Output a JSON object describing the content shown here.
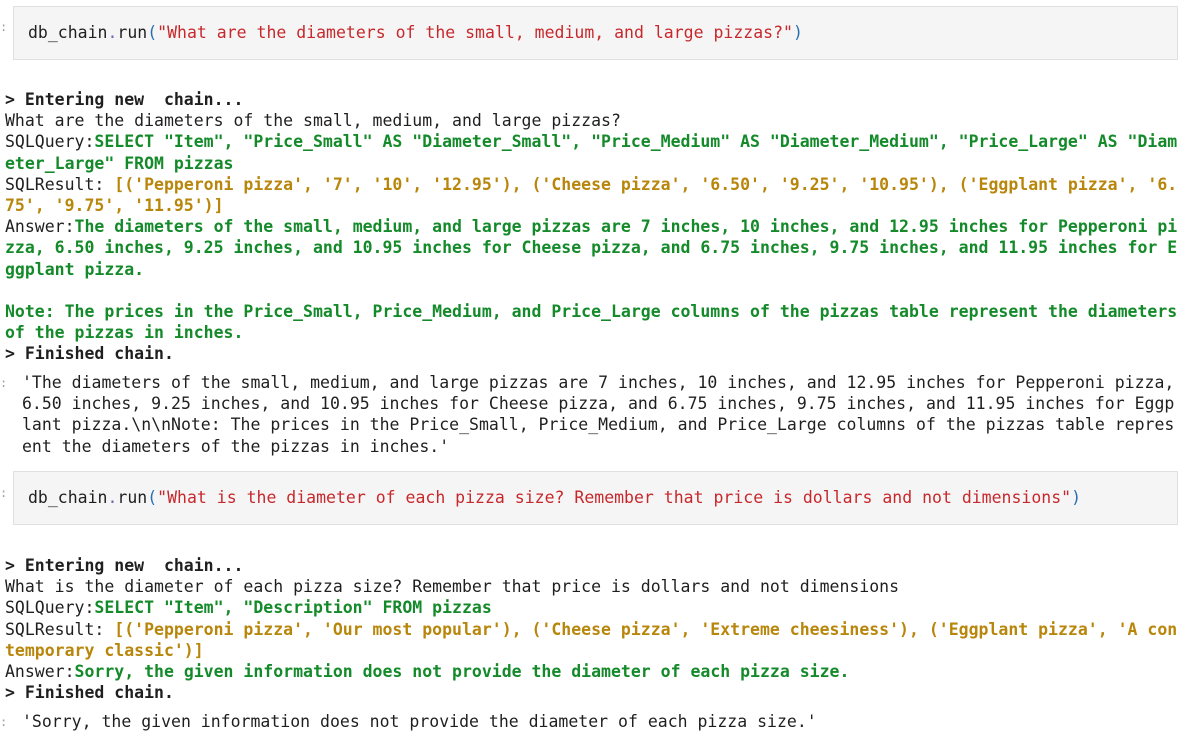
{
  "cells": [
    {
      "input": {
        "obj": "db_chain",
        "dot": ".",
        "method": "run",
        "open_paren": "(",
        "string": "\"What are the diameters of the small, medium, and large pizzas?\"",
        "close_paren": ")"
      },
      "log": {
        "entering": "> Entering new  chain...",
        "question": "What are the diameters of the small, medium, and large pizzas?",
        "sql_label": "SQLQuery:",
        "sql_query": "SELECT \"Item\", \"Price_Small\" AS \"Diameter_Small\", \"Price_Medium\" AS \"Diameter_Medium\", \"Price_Large\" AS \"Diameter_Large\" FROM pizzas",
        "result_label": "SQLResult: ",
        "sql_result": "[('Pepperoni pizza', '7', '10', '12.95'), ('Cheese pizza', '6.50', '9.25', '10.95'), ('Eggplant pizza', '6.75', '9.75', '11.95')]",
        "answer_label": "Answer:",
        "answer": "The diameters of the small, medium, and large pizzas are 7 inches, 10 inches, and 12.95 inches for Pepperoni pizza, 6.50 inches, 9.25 inches, and 10.95 inches for Cheese pizza, and 6.75 inches, 9.75 inches, and 11.95 inches for Eggplant pizza.",
        "note": "Note: The prices in the Price_Small, Price_Medium, and Price_Large columns of the pizzas table represent the diameters of the pizzas in inches.",
        "finished": "> Finished chain."
      },
      "output": "'The diameters of the small, medium, and large pizzas are 7 inches, 10 inches, and 12.95 inches for Pepperoni pizza, 6.50 inches, 9.25 inches, and 10.95 inches for Cheese pizza, and 6.75 inches, 9.75 inches, and 11.95 inches for Eggplant pizza.\\n\\nNote: The prices in the Price_Small, Price_Medium, and Price_Large columns of the pizzas table represent the diameters of the pizzas in inches.'"
    },
    {
      "input": {
        "obj": "db_chain",
        "dot": ".",
        "method": "run",
        "open_paren": "(",
        "string": "\"What is the diameter of each pizza size? Remember that price is dollars and not dimensions\"",
        "close_paren": ")"
      },
      "log": {
        "entering": "> Entering new  chain...",
        "question": "What is the diameter of each pizza size? Remember that price is dollars and not dimensions",
        "sql_label": "SQLQuery:",
        "sql_query": "SELECT \"Item\", \"Description\" FROM pizzas",
        "result_label": "SQLResult: ",
        "sql_result": "[('Pepperoni pizza', 'Our most popular'), ('Cheese pizza', 'Extreme cheesiness'), ('Eggplant pizza', 'A contemporary classic')]",
        "answer_label": "Answer:",
        "answer": "Sorry, the given information does not provide the diameter of each pizza size.",
        "finished": "> Finished chain."
      },
      "output": "'Sorry, the given information does not provide the diameter of each pizza size.'"
    }
  ],
  "colors": {
    "string": "#c7282c",
    "green": "#148a2a",
    "yellow": "#b8860b",
    "cell_bg": "#f5f5f5"
  }
}
